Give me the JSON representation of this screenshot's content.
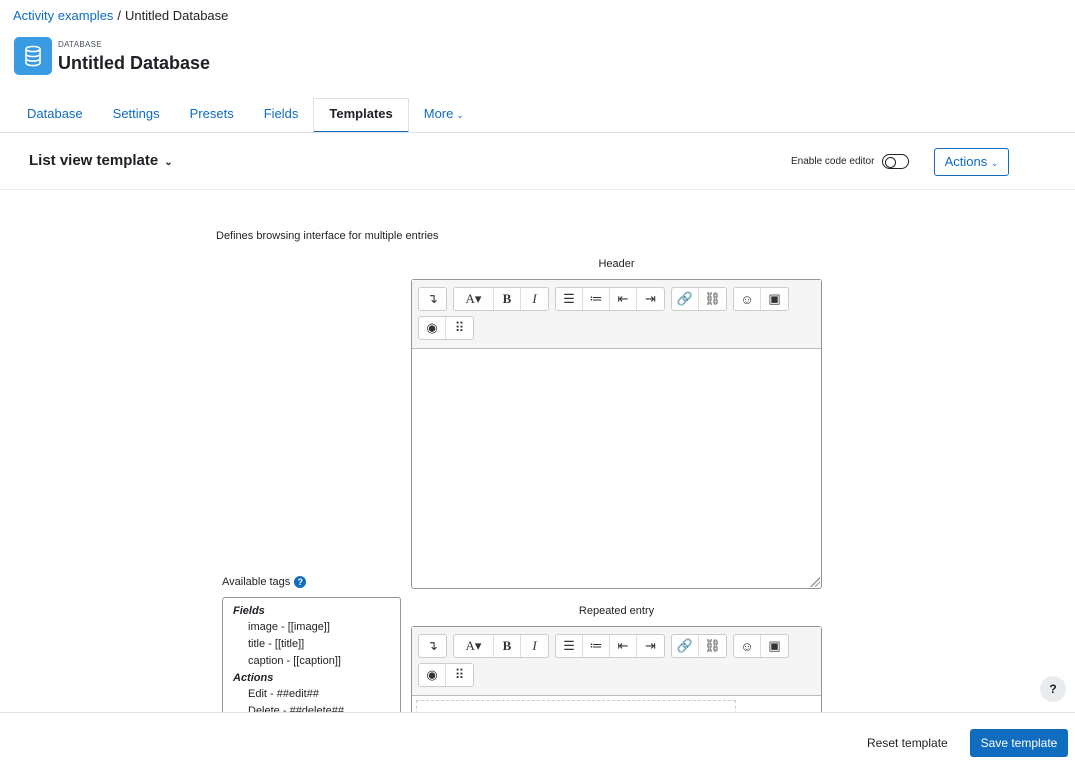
{
  "breadcrumb": {
    "parent": "Activity examples",
    "separator": "/",
    "current": "Untitled Database"
  },
  "header": {
    "type_label": "DATABASE",
    "title": "Untitled Database"
  },
  "tabs": [
    {
      "label": "Database"
    },
    {
      "label": "Settings"
    },
    {
      "label": "Presets"
    },
    {
      "label": "Fields"
    },
    {
      "label": "Templates"
    },
    {
      "label": "More"
    }
  ],
  "template_bar": {
    "title": "List view template",
    "code_editor_label": "Enable code editor",
    "actions_label": "Actions"
  },
  "description": "Defines browsing interface for multiple entries",
  "sections": {
    "header_label": "Header",
    "repeated_label": "Repeated entry"
  },
  "available_tags": {
    "label": "Available tags",
    "groups": [
      {
        "name": "Fields",
        "items": [
          "image - [[image]]",
          "title - [[title]]",
          "caption - [[caption]]"
        ]
      },
      {
        "name": "Actions",
        "items": [
          "Edit - ##edit##",
          "Delete - ##delete##"
        ]
      }
    ]
  },
  "footer": {
    "reset_label": "Reset template",
    "save_label": "Save template"
  },
  "help_label": "?",
  "colors": {
    "primary": "#0f6cbf",
    "db_icon": "#399be2"
  }
}
